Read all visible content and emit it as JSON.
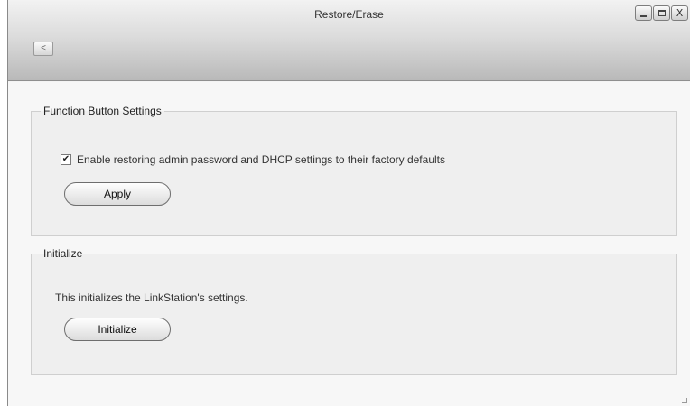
{
  "window": {
    "title": "Restore/Erase",
    "back_label": "<",
    "controls": {
      "close_label": "X"
    }
  },
  "function_button_settings": {
    "legend": "Function Button Settings",
    "checkbox_label": "Enable restoring admin password and DHCP settings to their factory defaults",
    "checkbox_checked": true,
    "apply_label": "Apply"
  },
  "initialize": {
    "legend": "Initialize",
    "description": "This initializes the LinkStation's settings.",
    "button_label": "Initialize"
  }
}
